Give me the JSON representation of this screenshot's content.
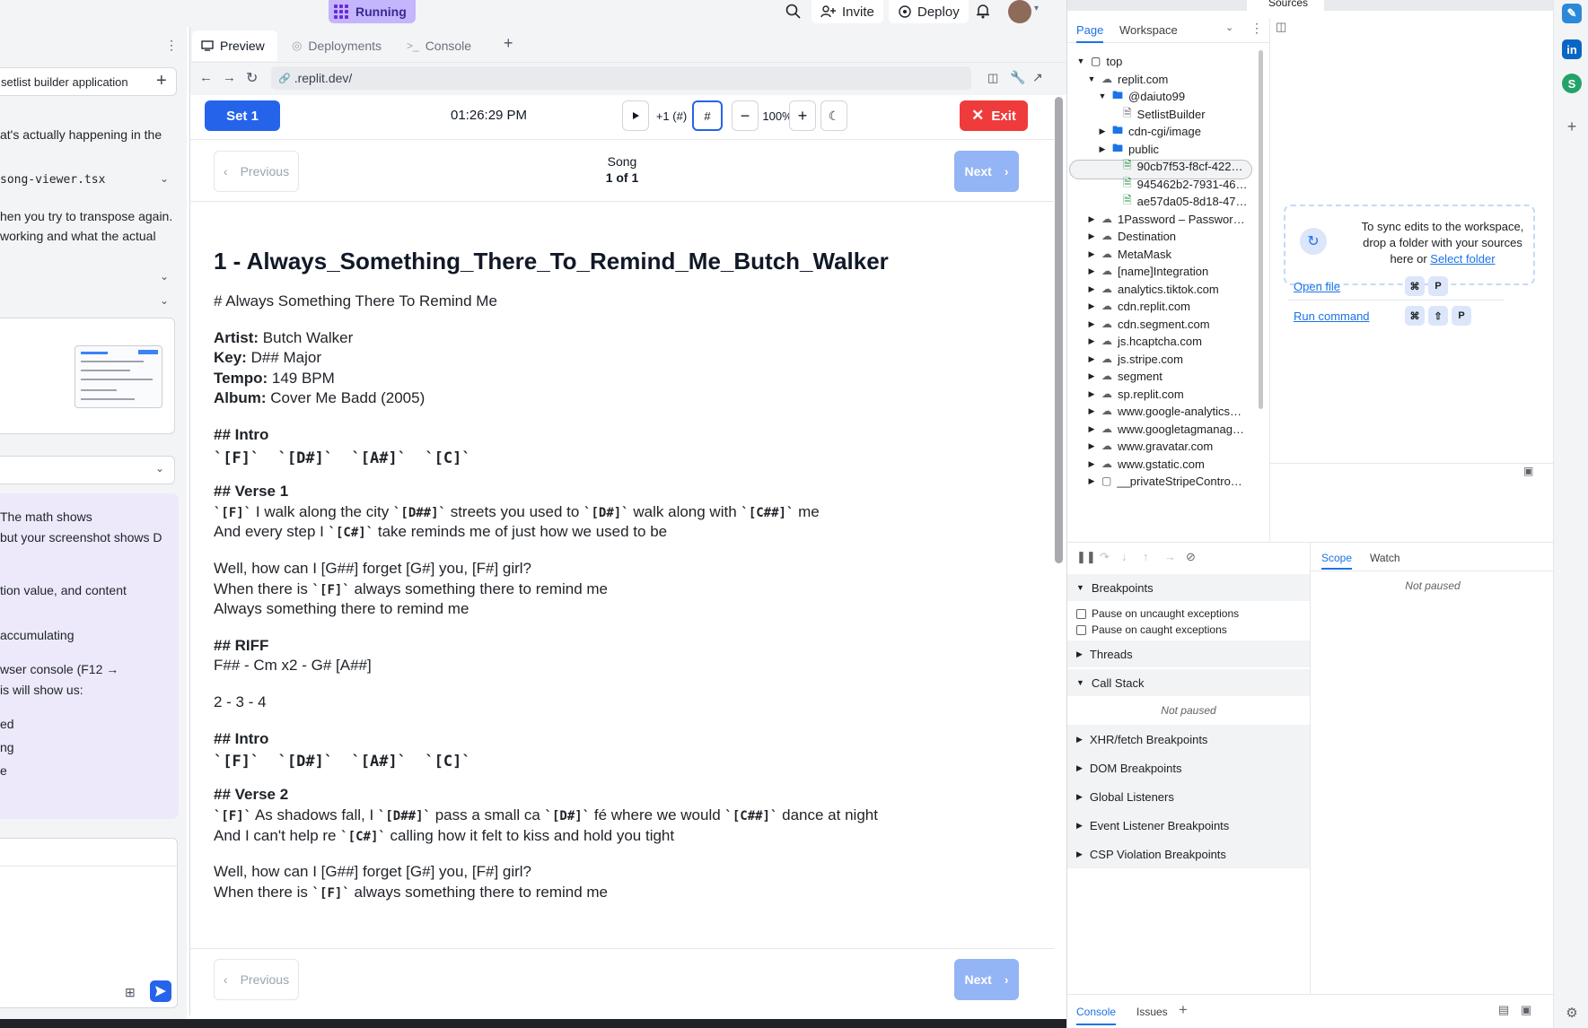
{
  "topbar": {
    "running_label": "Running",
    "invite_label": "Invite",
    "deploy_label": "Deploy"
  },
  "agent": {
    "task_title": "setlist builder application",
    "lines": [
      "at's actually happening in the",
      "song-viewer.tsx",
      "hen you try to transpose again.",
      "working and what the actual",
      "The math shows",
      "but your screenshot shows D",
      "tion value, and content",
      "accumulating",
      "wser console (F12 →",
      "is will show us:",
      "ed",
      "ng",
      "e"
    ]
  },
  "preview": {
    "tabs": [
      "Preview",
      "Deployments",
      "Console"
    ],
    "url": ".replit.dev/",
    "set_label": "Set 1",
    "clock": "01:26:29 PM",
    "transpose_label": "+1 (#)",
    "sharp_label": "#",
    "zoom": "100%",
    "exit_label": "Exit",
    "prev_label": "Previous",
    "next_label": "Next",
    "song_label": "Song",
    "song_count": "1 of 1"
  },
  "song": {
    "title": "1 - Always_Something_There_To_Remind_Me_Butch_Walker",
    "heading": "# Always Something There To Remind Me",
    "artist_key": "Artist:",
    "artist": "Butch Walker",
    "key_key": "Key:",
    "key": "D## Major",
    "tempo_key": "Tempo:",
    "tempo": "149 BPM",
    "album_key": "Album:",
    "album": "Cover Me Badd (2005)",
    "intro": "## Intro",
    "intro_chords": "`[F]`  `[D#]`  `[A#]`  `[C]`",
    "verse1": "## Verse 1",
    "v1_l1_a": "`[F]`",
    "v1_l1_b": " I walk along the city ",
    "v1_l1_c": "`[D##]`",
    "v1_l1_d": " streets you used to ",
    "v1_l1_e": "`[D#]`",
    "v1_l1_f": " walk along with ",
    "v1_l1_g": "`[C##]`",
    "v1_l1_h": " me",
    "v1_l2_a": "And every step I ",
    "v1_l2_b": "`[C#]`",
    "v1_l2_c": " take reminds me of just how we used to be",
    "ch_l1": "Well, how can I [G##] forget [G#] you, [F#] girl?",
    "ch_l2_a": "When there is ",
    "ch_l2_b": "`[F]`",
    "ch_l2_c": " always something there to remind me",
    "ch_l3": "Always something there to remind me",
    "riff": "## RIFF",
    "riff_l1": "F## - Cm x2 - G# [A##]",
    "riff_l2": "2 - 3 - 4",
    "intro2": "## Intro",
    "intro2_chords": "`[F]`  `[D#]`  `[A#]`  `[C]`",
    "verse2": "## Verse 2",
    "v2_l1_a": "`[F]`",
    "v2_l1_b": " As shadows fall, I ",
    "v2_l1_c": "`[D##]`",
    "v2_l1_d": " pass a small ca ",
    "v2_l1_e": "`[D#]`",
    "v2_l1_f": " fé where we would ",
    "v2_l1_g": "`[C##]`",
    "v2_l1_h": " dance at night",
    "v2_l2_a": "And I can't help re ",
    "v2_l2_b": "`[C#]`",
    "v2_l2_c": " calling how it felt to kiss and hold you tight",
    "ch2_l1": "Well, how can I [G##] forget [G#] you, [F#] girl?",
    "ch2_l2_a": "When there is ",
    "ch2_l2_b": "`[F]`",
    "ch2_l2_c": " always something there to remind me"
  },
  "devtools": {
    "panel_tab": "Sources",
    "nav_tabs": [
      "Page",
      "Workspace"
    ],
    "tree": [
      "top",
      "replit.com",
      "@daiuto99",
      "SetlistBuilder",
      "cdn-cgi/image",
      "public",
      "90cb7f53-f8cf-422…",
      "945462b2-7931-46…",
      "ae57da05-8d18-47…",
      "1Password – Passwor…",
      "Destination",
      "MetaMask",
      "[name]Integration",
      "analytics.tiktok.com",
      "cdn.replit.com",
      "cdn.segment.com",
      "js.hcaptcha.com",
      "js.stripe.com",
      "segment",
      "sp.replit.com",
      "www.google-analytics…",
      "www.googletagmanag…",
      "www.gravatar.com",
      "www.gstatic.com",
      "__privateStripeContro…"
    ],
    "sync_text": "To sync edits to the workspace, drop a folder with your sources here or",
    "select_folder": "Select folder",
    "open_file": "Open file",
    "run_command": "Run command",
    "key_cmd": "⌘",
    "key_p": "P",
    "key_shift": "⇧",
    "breakpoints": "Breakpoints",
    "pause_uncaught": "Pause on uncaught exceptions",
    "pause_caught": "Pause on caught exceptions",
    "threads": "Threads",
    "call_stack": "Call Stack",
    "not_paused": "Not paused",
    "xhr": "XHR/fetch Breakpoints",
    "dom": "DOM Breakpoints",
    "global": "Global Listeners",
    "event": "Event Listener Breakpoints",
    "csp": "CSP Violation Breakpoints",
    "scope": "Scope",
    "watch": "Watch",
    "drawer_console": "Console",
    "drawer_issues": "Issues"
  }
}
